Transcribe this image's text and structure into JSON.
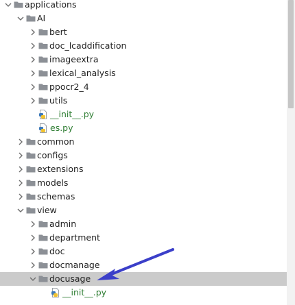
{
  "tree": {
    "rows": [
      {
        "label": "applications",
        "depth": 0,
        "expanded": true,
        "kind": "folder",
        "selected": false
      },
      {
        "label": "AI",
        "depth": 1,
        "expanded": true,
        "kind": "folder",
        "selected": false
      },
      {
        "label": "bert",
        "depth": 2,
        "expanded": false,
        "kind": "folder",
        "selected": false
      },
      {
        "label": "doc_lcaddification",
        "depth": 2,
        "expanded": false,
        "kind": "folder",
        "selected": false
      },
      {
        "label": "imageextra",
        "depth": 2,
        "expanded": false,
        "kind": "folder",
        "selected": false
      },
      {
        "label": "lexical_analysis",
        "depth": 2,
        "expanded": false,
        "kind": "folder",
        "selected": false
      },
      {
        "label": "ppocr2_4",
        "depth": 2,
        "expanded": false,
        "kind": "folder",
        "selected": false
      },
      {
        "label": "utils",
        "depth": 2,
        "expanded": false,
        "kind": "folder",
        "selected": false
      },
      {
        "label": "__init__.py",
        "depth": 2,
        "expanded": null,
        "kind": "python-file",
        "selected": false
      },
      {
        "label": "es.py",
        "depth": 2,
        "expanded": null,
        "kind": "python-file",
        "selected": false
      },
      {
        "label": "common",
        "depth": 1,
        "expanded": false,
        "kind": "folder",
        "selected": false
      },
      {
        "label": "configs",
        "depth": 1,
        "expanded": false,
        "kind": "folder",
        "selected": false
      },
      {
        "label": "extensions",
        "depth": 1,
        "expanded": false,
        "kind": "folder",
        "selected": false
      },
      {
        "label": "models",
        "depth": 1,
        "expanded": false,
        "kind": "folder",
        "selected": false
      },
      {
        "label": "schemas",
        "depth": 1,
        "expanded": false,
        "kind": "folder",
        "selected": false
      },
      {
        "label": "view",
        "depth": 1,
        "expanded": true,
        "kind": "folder",
        "selected": false
      },
      {
        "label": "admin",
        "depth": 2,
        "expanded": false,
        "kind": "folder",
        "selected": false
      },
      {
        "label": "department",
        "depth": 2,
        "expanded": false,
        "kind": "folder",
        "selected": false
      },
      {
        "label": "doc",
        "depth": 2,
        "expanded": false,
        "kind": "folder",
        "selected": false
      },
      {
        "label": "docmanage",
        "depth": 2,
        "expanded": false,
        "kind": "folder",
        "selected": false
      },
      {
        "label": "docusage",
        "depth": 2,
        "expanded": true,
        "kind": "folder",
        "selected": true
      },
      {
        "label": "__init__.py",
        "depth": 3,
        "expanded": null,
        "kind": "python-file",
        "selected": false
      }
    ]
  },
  "colors": {
    "folder": "#8c9096",
    "python_file_text": "#2e7d32",
    "selection_bg": "#cbcbcb",
    "annotation_arrow": "#3b3fc9"
  },
  "annotation": {
    "type": "arrow",
    "points_to": "docusage"
  }
}
